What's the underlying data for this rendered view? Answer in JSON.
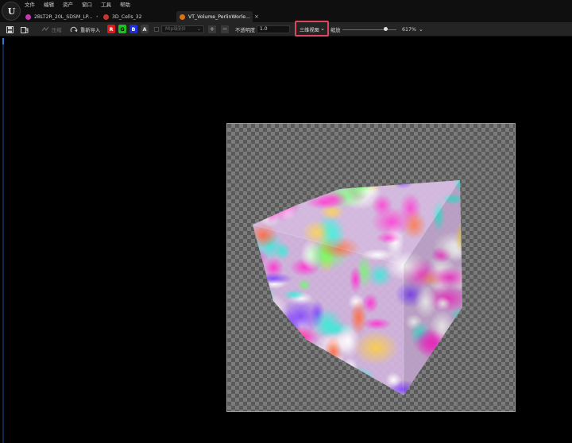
{
  "menu": {
    "items": [
      "文件",
      "编辑",
      "资产",
      "窗口",
      "工具",
      "帮助"
    ]
  },
  "tabs": [
    {
      "label": "2BLT2R_20L_SDSM_LP...",
      "icon_color": "#c03db0",
      "active": false,
      "suffix": "•"
    },
    {
      "label": "3D_Cells_32",
      "icon_color": "#c0392b",
      "active": false,
      "suffix": ""
    },
    {
      "label": "VT_Volume_PerlinWorle...",
      "icon_color": "#d4731a",
      "active": true,
      "suffix": "×"
    }
  ],
  "toolbar": {
    "save_icon": "save-icon",
    "browse_icon": "browse-asset-icon",
    "compress_label": "压缩",
    "reimport_label": "重新导入",
    "channels": [
      "R",
      "G",
      "B",
      "A"
    ],
    "mip_placeholder": "Mip级别0",
    "opacity_label": "不透明度",
    "opacity_value": "1.0",
    "view_mode_label": "三维视图",
    "zoom_label": "缩放",
    "zoom_value": "617%",
    "zoom_fraction": 0.8
  },
  "colors": {
    "highlight_border": "#e0455e",
    "channel_r": "#e01a1a",
    "channel_g": "#1ec21e",
    "channel_b": "#1b2fe0"
  }
}
